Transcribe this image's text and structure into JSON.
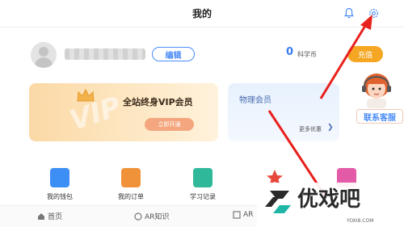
{
  "header": {
    "title": "我的"
  },
  "profile": {
    "edit_label": "编辑",
    "coins": "0",
    "coins_label": "科学币",
    "recharge_label": "充值"
  },
  "vip": {
    "title": "全站终身VIP会员",
    "watermark": "VIP",
    "button": "立即开通"
  },
  "physics": {
    "title": "物理会员",
    "more": "更多优惠"
  },
  "service": {
    "label": "联系客服"
  },
  "menu": {
    "items": [
      {
        "label": "我的钱包",
        "color": "#3d8ef5"
      },
      {
        "label": "我的订单",
        "color": "#f0923a"
      },
      {
        "label": "学习记录",
        "color": "#2fb89a"
      },
      {
        "label": "",
        "color": "#e8483b"
      },
      {
        "label": "",
        "color": "#e35aa6"
      }
    ]
  },
  "tabs": {
    "home": "首页",
    "ar": "AR知识",
    "ar2": "AR"
  },
  "watermark": {
    "text": "优戏吧",
    "url": "YOXI8.COM"
  },
  "colors": {
    "accent": "#4a8cf7",
    "arrow": "#e8201c",
    "recharge": "#f5a623"
  }
}
